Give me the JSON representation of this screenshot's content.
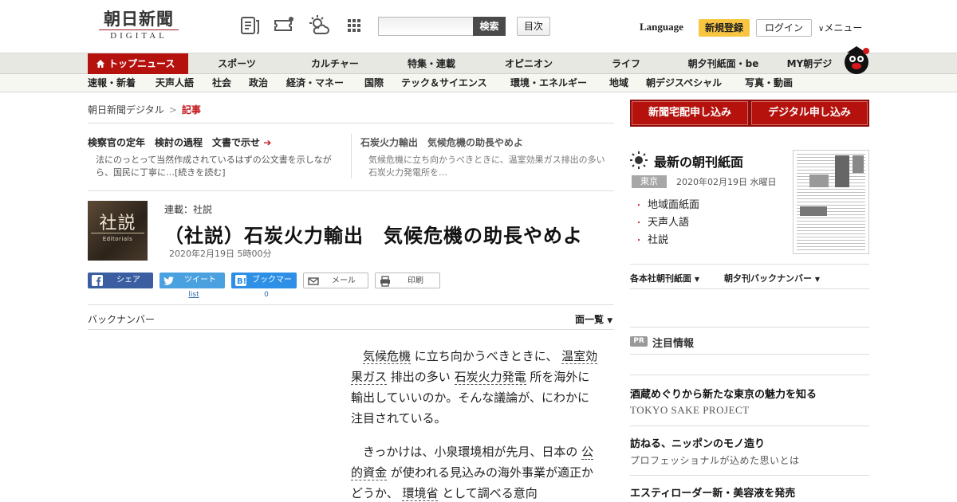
{
  "header": {
    "logo_main": "朝日新聞",
    "logo_sub": "DIGITAL",
    "search_button": "検索",
    "search_placeholder": "",
    "index_button": "目次",
    "language": "Language",
    "register": "新規登録",
    "login": "ログイン",
    "menu": "メニュー"
  },
  "nav": {
    "primary": [
      "トップニュース",
      "スポーツ",
      "カルチャー",
      "特集・連載",
      "オピニオン",
      "ライフ",
      "朝夕刊紙面・be",
      "MY朝デジ"
    ],
    "secondary": [
      "速報・新着",
      "天声人語",
      "社会",
      "政治",
      "経済・マネー",
      "国際",
      "テック＆サイエンス",
      "環境・エネルギー",
      "地域",
      "朝デジスペシャル",
      "写真・動画"
    ]
  },
  "breadcrumb": {
    "home": "朝日新聞デジタル",
    "sep": ">",
    "current": "記事"
  },
  "related": [
    {
      "title": "検察官の定年　検討の過程　文書で示せ",
      "desc": "法にのっとって当然作成されているはずの公文書を示しながら、国民に丁寧に…",
      "more": "[続きを読む]"
    },
    {
      "title": "石炭火力輸出　気候危機の助長やめよ",
      "desc": "気候危機に立ち向かうべきときに、温室効果ガス排出の多い石炭火力発電所を…"
    }
  ],
  "article": {
    "thumb_kanji": "社説",
    "thumb_en": "Editorials",
    "series": "連載：社説",
    "headline": "（社説）石炭火力輸出　気候危機の助長やめよ",
    "date": "2020年2月19日 5時00分",
    "share": {
      "facebook": "シェア",
      "twitter": "ツイート",
      "hatena": "ブックマーク",
      "mail": "メール",
      "print": "印刷",
      "twitter_count": "list",
      "hatena_count": "0"
    },
    "back_numbers": "バックナンバー",
    "page_list": "面一覧",
    "body": [
      [
        {
          "t": "気候危機",
          "kw": true
        },
        {
          "t": " に立ち向かうべきときに、 "
        },
        {
          "t": "温室効果ガス",
          "kw": true
        },
        {
          "t": " 排出の多い "
        },
        {
          "t": "石炭火力発電",
          "kw": true
        },
        {
          "t": " 所を海外に輸出していいのか。そんな議論が、にわかに注目されている。"
        }
      ],
      [
        {
          "t": "きっかけは、小泉環境相が先月、日本の "
        },
        {
          "t": "公的資金",
          "kw": true
        },
        {
          "t": " が使われる見込みの海外事業が適正かどうか、 "
        },
        {
          "t": "環境省",
          "kw": true
        },
        {
          "t": " として調べる意向"
        }
      ]
    ]
  },
  "sidebar": {
    "buy_paper": "新聞宅配申し込み",
    "buy_digital": "デジタル申し込み",
    "latest_title": "最新の朝刊紙面",
    "region_badge": "東京",
    "edition_date": "2020年02月19日 水曜日",
    "links": [
      "地域面紙面",
      "天声人語",
      "社説"
    ],
    "dropdown1": "各本社朝刊紙面",
    "dropdown2": "朝夕刊バックナンバー",
    "pr_badge": "PR",
    "pr_label": "注目情報",
    "ads": [
      {
        "title": "酒蔵めぐりから新たな東京の魅力を知る",
        "sub": "TOKYO SAKE PROJECT"
      },
      {
        "title": "訪ねる、ニッポンのモノ造り",
        "sub": "プロフェッショナルが込めた思いとは"
      },
      {
        "title": "エスティローダー新・美容液を発売",
        "sub": ""
      }
    ]
  },
  "colors": {
    "brand_red": "#b5120e",
    "register_yellow": "#f8c541",
    "facebook": "#3b5ea1",
    "twitter": "#4aa1e0",
    "hatena": "#2d8fe6"
  },
  "icons": [
    "newspaper-icon",
    "ticket-icon",
    "weather-icon",
    "grid-icon",
    "home-icon",
    "mascot-icon",
    "facebook-icon",
    "twitter-icon",
    "hatena-icon",
    "mail-icon",
    "print-icon",
    "sun-icon",
    "chevron-down-icon",
    "arrow-right-icon"
  ]
}
